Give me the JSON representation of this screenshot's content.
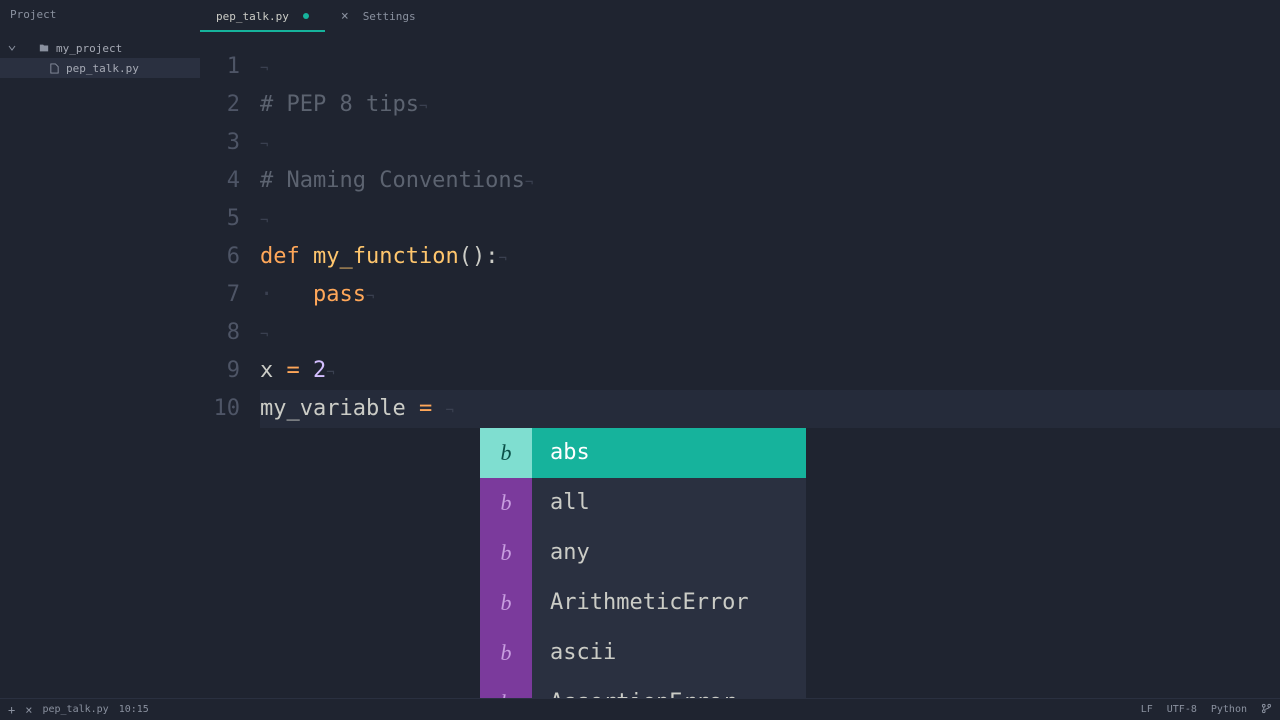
{
  "project": {
    "panel_label": "Project",
    "root_folder": "my_project",
    "files": [
      {
        "name": "pep_talk.py",
        "selected": true
      }
    ]
  },
  "tabs": [
    {
      "label": "pep_talk.py",
      "dirty": true,
      "active": true
    },
    {
      "label": "Settings",
      "dirty": false,
      "active": false,
      "closable": true
    }
  ],
  "editor": {
    "lines": [
      {
        "num": "1",
        "tokens": []
      },
      {
        "num": "2",
        "tokens": [
          {
            "t": "# PEP 8 tips",
            "c": "comment"
          }
        ]
      },
      {
        "num": "3",
        "tokens": []
      },
      {
        "num": "4",
        "tokens": [
          {
            "t": "# Naming Conventions",
            "c": "comment"
          }
        ]
      },
      {
        "num": "5",
        "tokens": []
      },
      {
        "num": "6",
        "tokens": [
          {
            "t": "def",
            "c": "keyword"
          },
          {
            "t": " ",
            "c": ""
          },
          {
            "t": "my_function",
            "c": "function-name"
          },
          {
            "t": "():",
            "c": "punctuation"
          }
        ]
      },
      {
        "num": "7",
        "indent": 1,
        "tokens": [
          {
            "t": "pass",
            "c": "keyword"
          }
        ]
      },
      {
        "num": "8",
        "tokens": []
      },
      {
        "num": "9",
        "tokens": [
          {
            "t": "x ",
            "c": "identifier"
          },
          {
            "t": "=",
            "c": "keyword"
          },
          {
            "t": " ",
            "c": ""
          },
          {
            "t": "2",
            "c": "number"
          }
        ]
      },
      {
        "num": "10",
        "active": true,
        "tokens": [
          {
            "t": "my_variable ",
            "c": "identifier"
          },
          {
            "t": "=",
            "c": "keyword"
          },
          {
            "t": " ",
            "c": ""
          }
        ]
      }
    ]
  },
  "autocomplete": {
    "items": [
      {
        "badge": "b",
        "label": "abs",
        "selected": true
      },
      {
        "badge": "b",
        "label": "all"
      },
      {
        "badge": "b",
        "label": "any"
      },
      {
        "badge": "b",
        "label": "ArithmeticError"
      },
      {
        "badge": "b",
        "label": "ascii"
      },
      {
        "badge": "b",
        "label": "AssertionError"
      }
    ]
  },
  "status": {
    "file": "pep_talk.py",
    "cursor": "10:15",
    "line_ending": "LF",
    "encoding": "UTF-8",
    "language": "Python",
    "branch_icon": true
  }
}
